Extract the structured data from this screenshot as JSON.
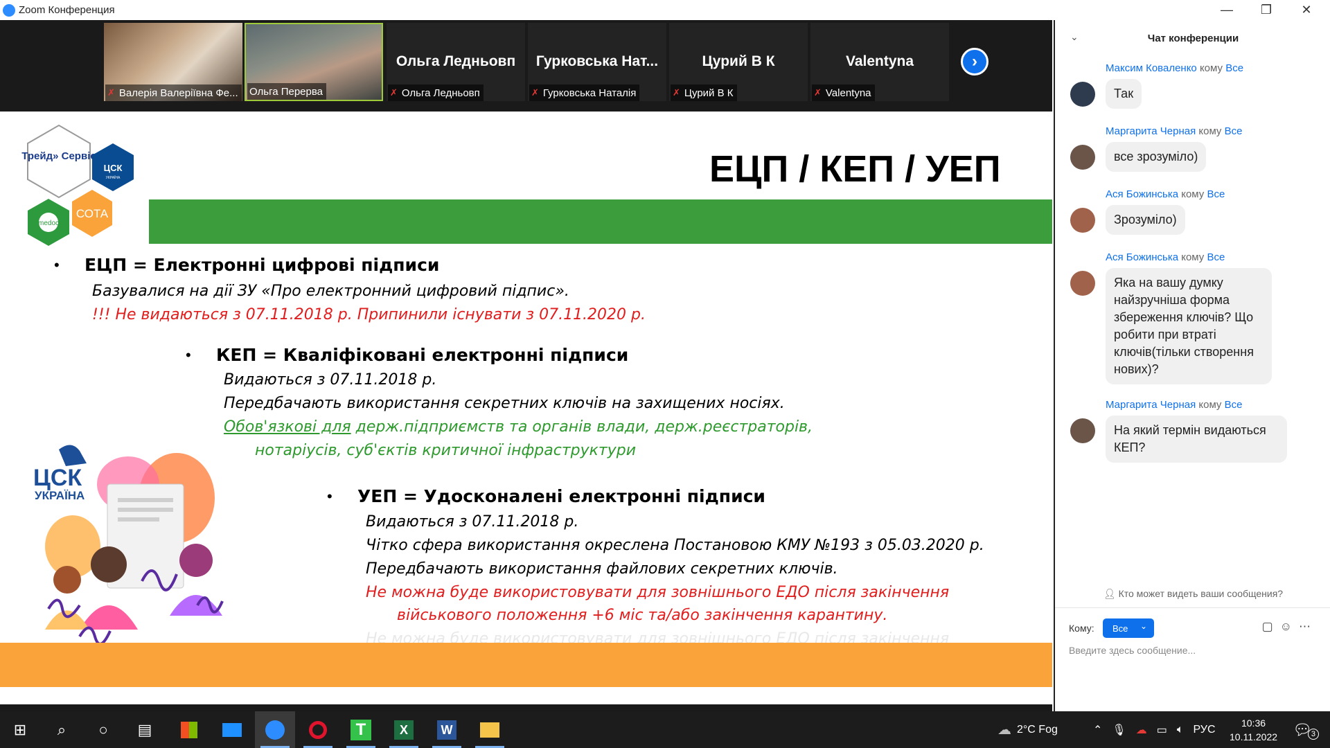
{
  "window": {
    "title": "Zoom Конференция"
  },
  "participants": [
    {
      "name": "Валерія Валеріївна Фе...",
      "video": true
    },
    {
      "name": "Ольга Перерва",
      "video": true
    },
    {
      "display": "Ольга Ледньовп",
      "name": "Ольга Ледньовп"
    },
    {
      "display": "Гурковська Нат...",
      "name": "Гурковська Наталія"
    },
    {
      "display": "Цурий В К",
      "name": "Цурий В К"
    },
    {
      "display": "Valentyna",
      "name": "Valentyna"
    }
  ],
  "slide": {
    "title": "ЕЦП / КЕП / УЕП",
    "logos": {
      "trade": "Трейд» Сервіс",
      "csk": "ЦСК",
      "csk_sub": "УКРАЇНА",
      "medoc": "medoc",
      "sota": "СОТА",
      "csk_big": "ЦСК",
      "csk_big_sub": "УКРАЇНА"
    },
    "ecp": {
      "heading": "ЕЦП = Електронні цифрові підписи",
      "line1": "Базувалися на дії ЗУ «Про електронний цифровий підпис».",
      "line2": "!!! Не видаються з 07.11.2018 р.     Припинили існувати з 07.11.2020 р."
    },
    "kep": {
      "heading": "КЕП = Кваліфіковані електронні підписи",
      "line1": "Видаються з 07.11.2018 р.",
      "line2": "Передбачають використання секретних ключів на захищених носіях.",
      "line3a": "Обов'язкові для",
      "line3b": " держ.підприємств та органів влади, держ.реєстраторів,",
      "line4": "нотаріусів, суб'єктів критичної інфраструктури"
    },
    "uep": {
      "heading": "УЕП = Удосконалені електронні підписи",
      "line1": "Видаються з 07.11.2018 р.",
      "line2": "Чітко сфера використання окреслена Постановою КМУ №193 з 05.03.2020 р.",
      "line3": "Передбачають використання файлових секретних ключів.",
      "line4": "Не можна буде використовувати для зовнішнього ЕДО після закінчення",
      "line5": "військового положення +6 міс та/або закінчення карантину.",
      "ghost": "Не можна буде використовувати для зовнішнього ЕДО після закінчення"
    }
  },
  "chat": {
    "title": "Чат конференции",
    "to_word": "кому",
    "messages": [
      {
        "sender": "Максим Коваленко",
        "to": "Все",
        "text": "Так"
      },
      {
        "sender": "Маргарита Черная",
        "to": "Все",
        "text": "все зрозуміло)"
      },
      {
        "sender": "Ася Божинська",
        "to": "Все",
        "text": "Зрозуміло)"
      },
      {
        "sender": "Ася Божинська",
        "to": "Все",
        "text": "Яка на вашу думку найзручніша форма збереження ключів? Що робити при втраті ключів(тільки створення нових)?"
      },
      {
        "sender": "Маргарита Черная",
        "to": "Все",
        "text": "На який термін  видаються КЕП?"
      }
    ],
    "privacy": "Кто может видеть ваши сообщения?",
    "to_label": "Кому:",
    "to_value": "Все",
    "placeholder": "Введите здесь сообщение..."
  },
  "taskbar": {
    "weather": "2°C  Fog",
    "lang": "РУС",
    "time": "10:36",
    "date": "10.11.2022",
    "notifications": "3"
  }
}
